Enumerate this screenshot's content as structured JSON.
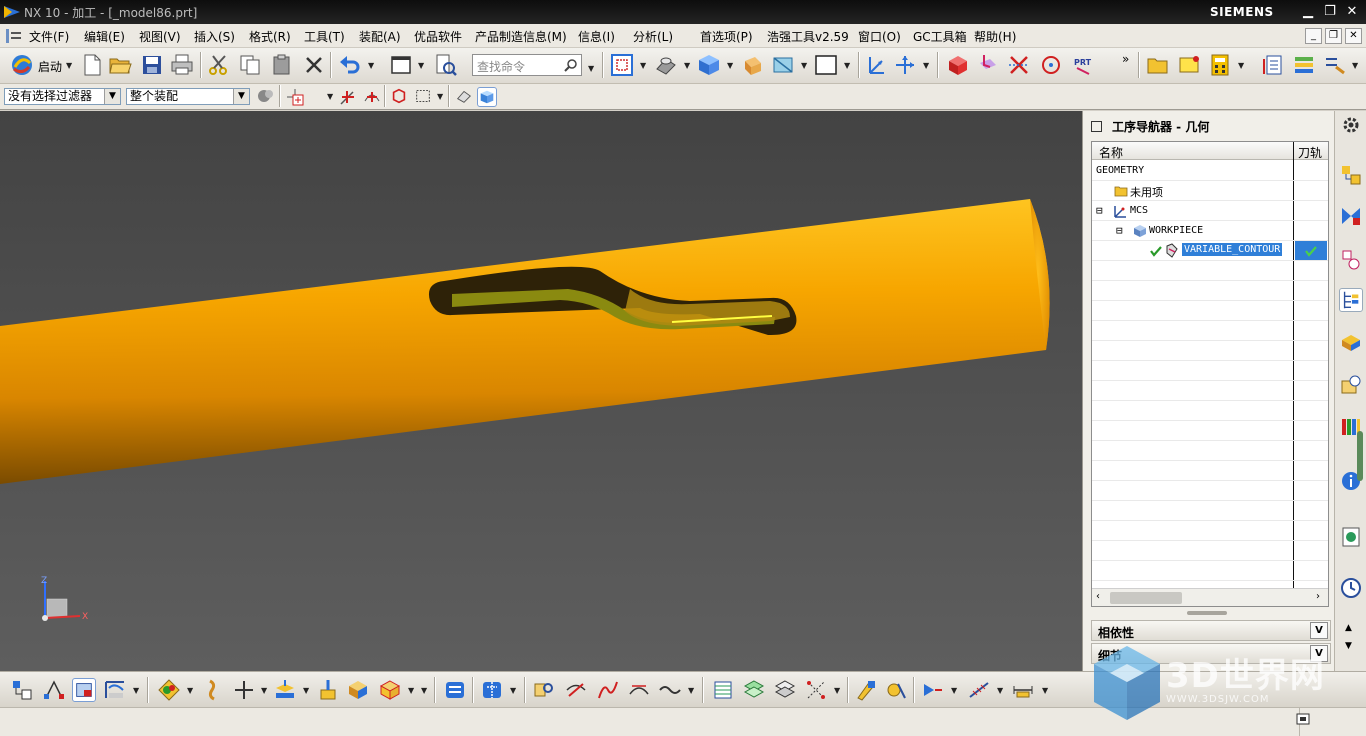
{
  "window": {
    "title": "NX 10 - 加工 - [_model86.prt]",
    "brand": "SIEMENS",
    "minimize": "▁",
    "restore": "❐",
    "close": "✕"
  },
  "menu": {
    "items": [
      "文件(F)",
      "编辑(E)",
      "视图(V)",
      "插入(S)",
      "格式(R)",
      "工具(T)",
      "装配(A)",
      "优品软件",
      "产品制造信息(M)",
      "信息(I)",
      "分析(L)",
      "首选项(P)",
      "浩强工具v2.59",
      "窗口(O)",
      "GC工具箱",
      "帮助(H)"
    ],
    "child_min": "_",
    "child_restore": "❐",
    "child_close": "✕"
  },
  "toolbar": {
    "start_label": "启动",
    "search_placeholder": "查找命令",
    "overflow": "»"
  },
  "selection": {
    "filter": "没有选择过滤器",
    "scope": "整个装配",
    "arrow": "▼"
  },
  "navigator": {
    "title": "工序导航器 - 几何",
    "columns": [
      "名称",
      "刀轨"
    ],
    "rows": [
      {
        "label": "GEOMETRY",
        "expander": "",
        "icon": "none"
      },
      {
        "label": "未用项",
        "expander": "",
        "icon": "folder-icon"
      },
      {
        "label": "MCS",
        "expander": "⊟",
        "icon": "mcs-icon"
      },
      {
        "label": "WORKPIECE",
        "expander": "⊟",
        "icon": "workpiece-icon"
      },
      {
        "label": "VARIABLE_CONTOUR",
        "expander": "",
        "icon": "operation-icon",
        "status": "✔",
        "selected": true
      }
    ],
    "sections": [
      "相依性",
      "细节"
    ],
    "section_chevron": "V"
  },
  "watermark": {
    "text": "3D世界网",
    "url": "WWW.3DSJW.COM"
  },
  "triad": {
    "z": "Z",
    "x": "X"
  },
  "colors": {
    "part_orange": "#f5a400",
    "selection_blue": "#2f7fd8",
    "check_green": "#2a9a2a"
  }
}
